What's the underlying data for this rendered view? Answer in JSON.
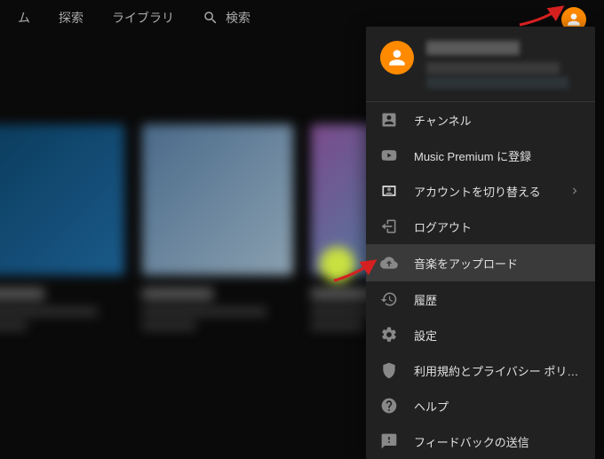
{
  "nav": {
    "home_fragment": "ム",
    "explore": "探索",
    "library": "ライブラリ",
    "search_label": "検索"
  },
  "dropdown": {
    "items": [
      {
        "icon": "account-box",
        "label": "チャンネル"
      },
      {
        "icon": "youtube",
        "label": "Music Premium に登録"
      },
      {
        "icon": "switch-account",
        "label": "アカウントを切り替える",
        "chevron": true
      },
      {
        "icon": "logout",
        "label": "ログアウト"
      },
      {
        "icon": "cloud-upload",
        "label": "音楽をアップロード",
        "highlighted": true
      },
      {
        "icon": "history",
        "label": "履歴"
      },
      {
        "icon": "settings",
        "label": "設定"
      },
      {
        "icon": "shield",
        "label": "利用規約とプライバシー ポリ…"
      },
      {
        "icon": "help",
        "label": "ヘルプ"
      },
      {
        "icon": "feedback",
        "label": "フィードバックの送信"
      }
    ]
  },
  "colors": {
    "accent": "#ff8a00",
    "panel": "#212121",
    "arrow": "#d62020"
  }
}
